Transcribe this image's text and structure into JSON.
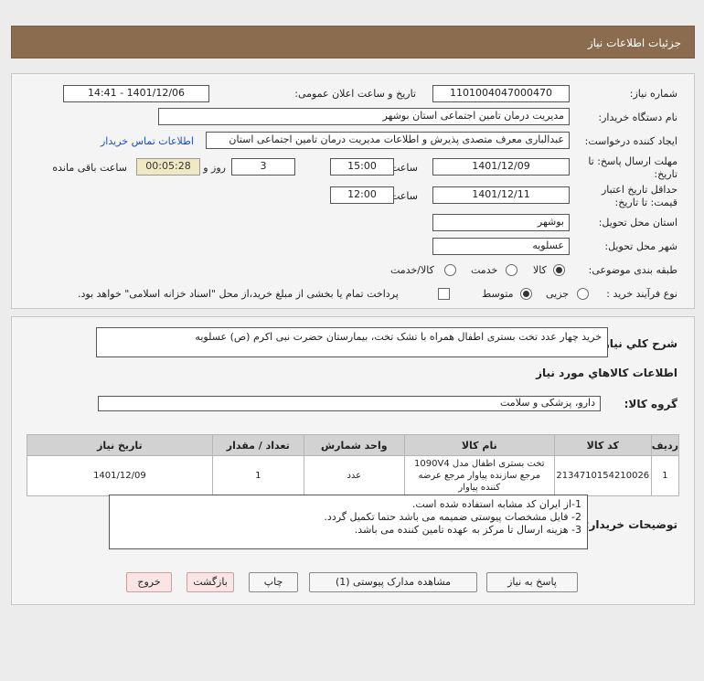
{
  "header": {
    "title": "جزئیات اطلاعات نیاز"
  },
  "form": {
    "need_number_label": "شماره نیاز:",
    "need_number": "1101004047000470",
    "announce_label": "تاریخ و ساعت اعلان عمومی:",
    "announce_value": "1401/12/06 - 14:41",
    "buyer_label": "نام دستگاه خریدار:",
    "buyer_value": "مدیریت درمان تامین اجتماعی استان بوشهر",
    "creator_label": "ایجاد کننده درخواست:",
    "creator_value": "عبدالباری معرف متصدی پذیرش و اطلاعات مدیریت درمان تامین اجتماعی استان",
    "contact_link": "اطلاعات تماس خریدار",
    "deadline_label": "مهلت ارسال پاسخ: تا تاریخ:",
    "deadline_date": "1401/12/09",
    "time_label": "ساعت",
    "deadline_time": "15:00",
    "days_value": "3",
    "days_label": "روز و",
    "remaining_value": "00:05:28",
    "remaining_label": "ساعت باقی مانده",
    "validity_label": "حداقل تاریخ اعتبار قیمت: تا تاریخ:",
    "validity_date": "1401/12/11",
    "validity_time": "12:00",
    "province_label": "استان محل تحویل:",
    "province_value": "بوشهر",
    "city_label": "شهر محل تحویل:",
    "city_value": "عسلویه",
    "category_label": "طبقه بندی موضوعی:",
    "category_options": [
      "کالا",
      "خدمت",
      "کالا/خدمت"
    ],
    "process_label": "نوع فرآیند خرید :",
    "process_options": [
      "جزیی",
      "متوسط"
    ],
    "payment_note": "پرداخت تمام یا بخشی از مبلغ خرید،از محل \"اسناد خزانه اسلامی\" خواهد بود."
  },
  "summary": {
    "label": "شرح کلي نياز:",
    "value": "خرید چهار عدد تخت بستری اطفال همراه با تشک تخت، بیمارستان حضرت نبی اکرم (ص) عسلویه"
  },
  "goods": {
    "title": "اطلاعات کالاهاي مورد نياز",
    "group_label": "گروه کالا:",
    "group_value": "دارو، پزشکی و سلامت",
    "columns": [
      "ردیف",
      "کد کالا",
      "نام کالا",
      "واحد شمارش",
      "تعداد / مقدار",
      "تاریخ نیاز"
    ],
    "rows": [
      [
        "1",
        "2134710154210026",
        "تخت بستری اطفال مدل 1090V4 مرجع سازنده پیاوار مرجع عرضه کننده پیاوار",
        "عدد",
        "1",
        "1401/12/09"
      ]
    ]
  },
  "buyer_notes": {
    "label": "توضیحات خریدار:",
    "lines": [
      "1-از ایران کد مشابه استفاده شده است.",
      "2- فایل مشخصات پیوستی ضمیمه می باشد حتما تکمیل گردد.",
      "3- هزینه ارسال تا مرکز به عهده تامین کننده می باشد."
    ]
  },
  "buttons": {
    "reply": "پاسخ به نیاز",
    "attachments": "مشاهده مدارک پیوستی (1)",
    "print": "چاپ",
    "back": "بازگشت",
    "exit": "خروج"
  }
}
